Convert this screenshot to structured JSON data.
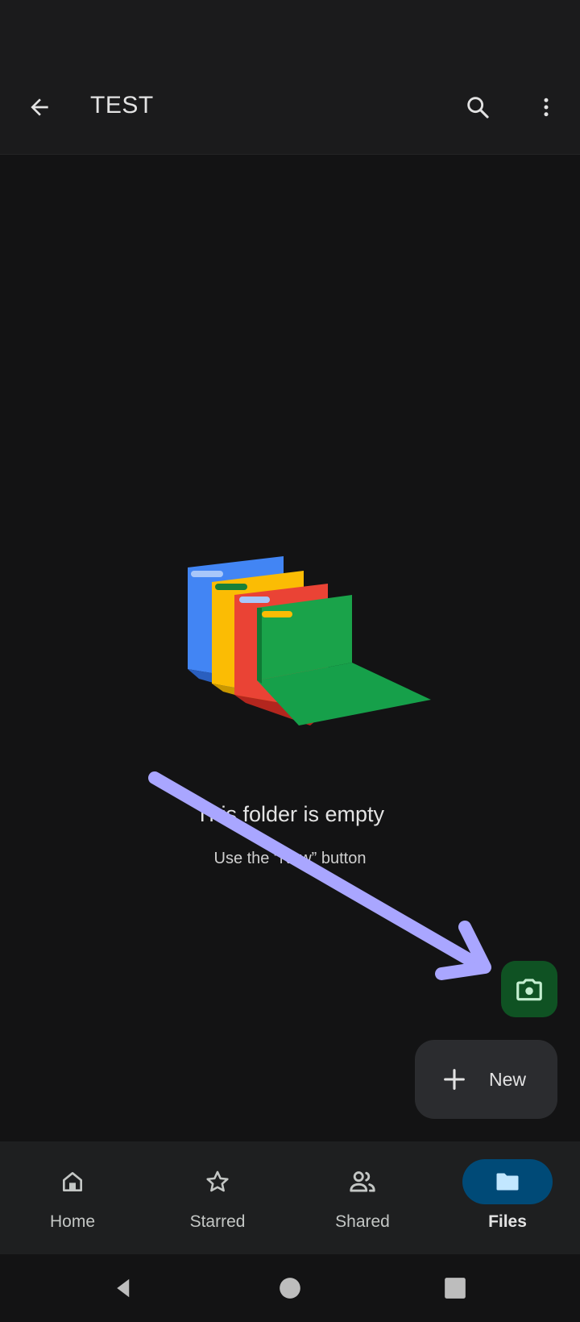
{
  "header": {
    "title": "TEST",
    "back_icon": "arrow-back-icon",
    "search_icon": "search-icon",
    "more_icon": "more-vert-icon"
  },
  "empty_state": {
    "title": "This folder is empty",
    "subtitle": "Use the “New” button"
  },
  "fab": {
    "camera_icon": "camera-icon",
    "new_label": "New"
  },
  "nav": {
    "items": [
      {
        "label": "Home",
        "icon": "home-icon"
      },
      {
        "label": "Starred",
        "icon": "star-icon"
      },
      {
        "label": "Shared",
        "icon": "shared-people-icon"
      },
      {
        "label": "Files",
        "icon": "folder-icon",
        "active": true
      }
    ]
  },
  "colors": {
    "background": "#131314",
    "camera_fab": "#0f5223",
    "active_nav_pill": "#004a77",
    "annotation_arrow": "#a9a6ff"
  }
}
